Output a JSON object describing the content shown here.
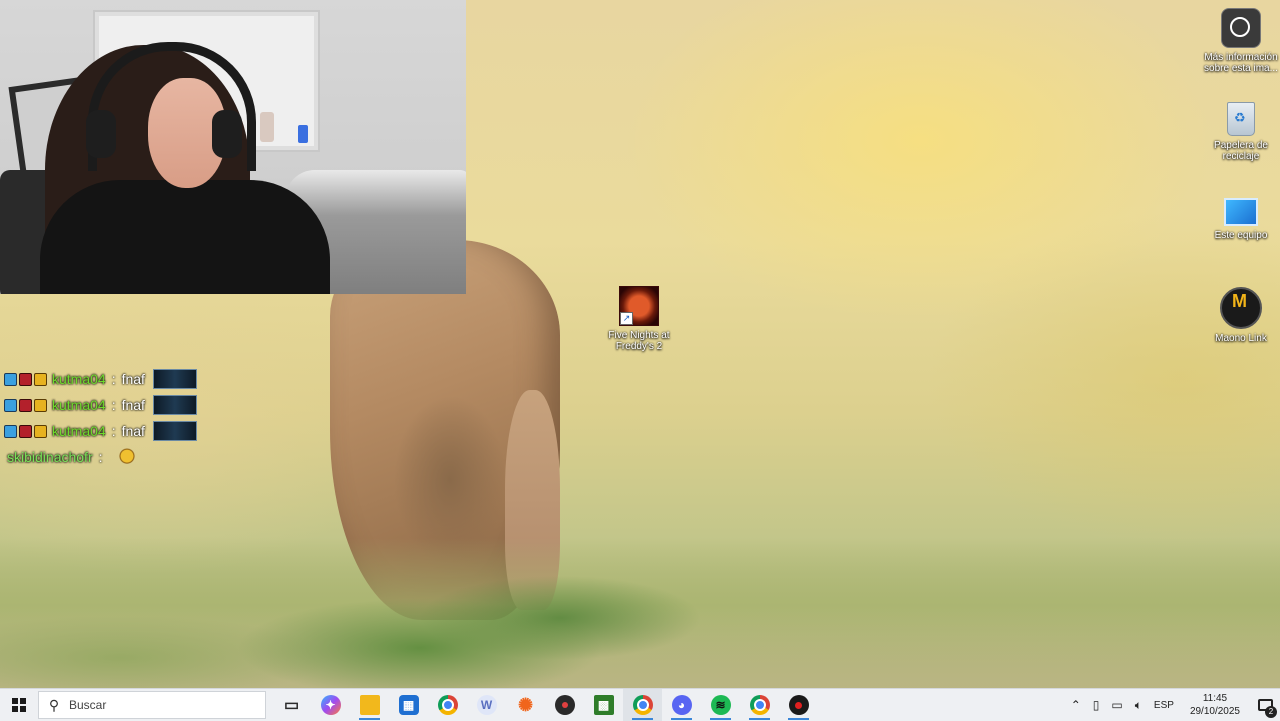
{
  "webcam": {
    "label": ""
  },
  "chat": {
    "messages": [
      {
        "user": "kutma04",
        "separator": ":",
        "text": "fnaf",
        "badges": [
          "prime-badge",
          "red-badge",
          "crown-badge"
        ],
        "emote": "emote-badge"
      },
      {
        "user": "kutma04",
        "separator": ":",
        "text": "fnaf",
        "badges": [
          "prime-badge",
          "red-badge",
          "crown-badge"
        ],
        "emote": "emote-badge"
      },
      {
        "user": "kutma04",
        "separator": ":",
        "text": "fnaf",
        "badges": [
          "prime-badge",
          "red-badge",
          "crown-badge"
        ],
        "emote": "emote-badge"
      },
      {
        "user": "skibidinachofr",
        "separator": ":",
        "text": "",
        "badges": [],
        "emote": "face-emote"
      }
    ]
  },
  "desktop": {
    "icons": {
      "info": {
        "label": "Más información sobre esta ima...",
        "icon": "info-camera-icon"
      },
      "recycle_bin": {
        "label": "Papelera de reciclaje",
        "icon": "recycle-bin-icon"
      },
      "this_pc": {
        "label": "Este equipo",
        "icon": "computer-icon"
      },
      "maono": {
        "label": "Maono Link",
        "icon": "maono-link-icon"
      },
      "fnaf": {
        "label": "Five Nights at Freddy's 2",
        "icon": "fnaf-game-icon"
      }
    }
  },
  "taskbar": {
    "search_placeholder": "Buscar",
    "apps": [
      {
        "name": "task-view",
        "glyph": "▭",
        "color": "#2b2b2b"
      },
      {
        "name": "copilot",
        "glyph": "✦",
        "color": "#7a5cf0"
      },
      {
        "name": "file-explorer",
        "glyph": "▆",
        "color": "#f2b81c"
      },
      {
        "name": "microsoft-store",
        "glyph": "▣",
        "color": "#1f6fd1"
      },
      {
        "name": "chrome",
        "glyph": "●",
        "color": "#2aa34a"
      },
      {
        "name": "writer",
        "glyph": "W",
        "color": "#c9d3ef"
      },
      {
        "name": "sun-app",
        "glyph": "✺",
        "color": "#f0651b"
      },
      {
        "name": "disc-app",
        "glyph": "◉",
        "color": "#3a3a3a"
      },
      {
        "name": "minecraft",
        "glyph": "▩",
        "color": "#2f7d2a"
      },
      {
        "name": "chrome-profile",
        "glyph": "●",
        "color": "#4a7fe0"
      },
      {
        "name": "discord",
        "glyph": "◕",
        "color": "#5865f2"
      },
      {
        "name": "spotify",
        "glyph": "≋",
        "color": "#1db954"
      },
      {
        "name": "chrome-profile-2",
        "glyph": "●",
        "color": "#2aa34a"
      },
      {
        "name": "game-app",
        "glyph": "◆",
        "color": "#1a1a1a"
      }
    ],
    "tray": {
      "language": "ESP",
      "time": "11:45",
      "date": "29/10/2025",
      "notification_count": "2"
    }
  }
}
